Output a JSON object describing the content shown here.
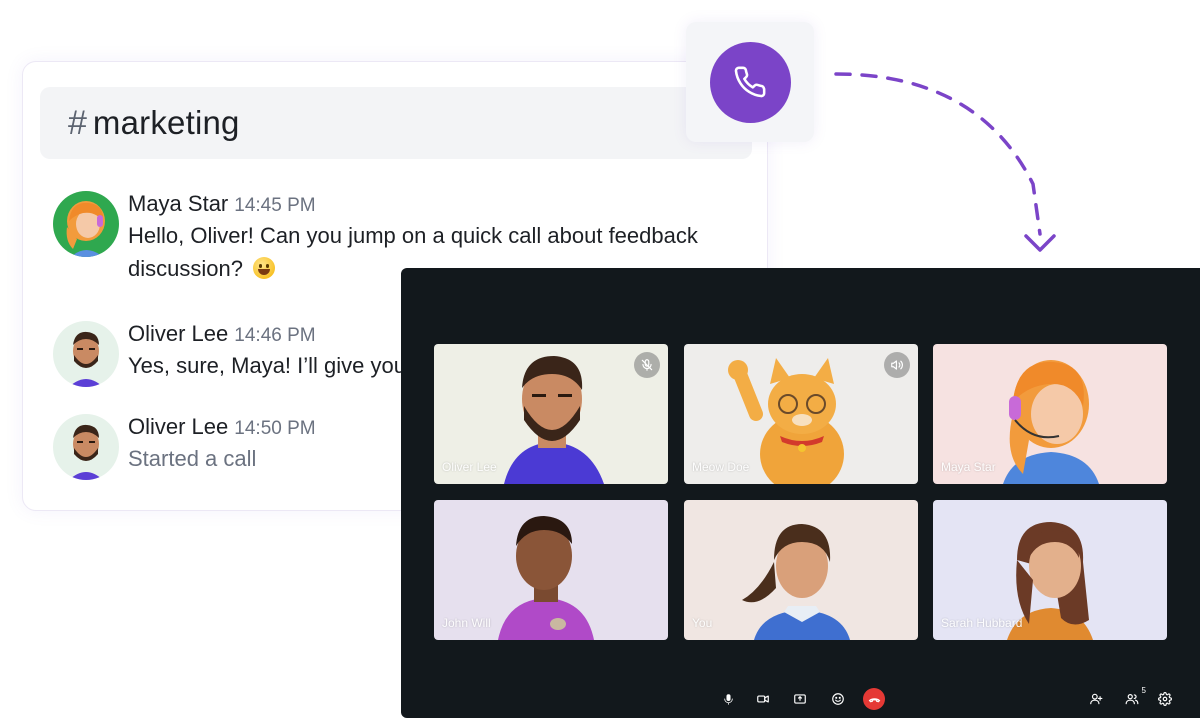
{
  "channel": {
    "hash": "#",
    "name": "marketing"
  },
  "messages": [
    {
      "author": "Maya Star",
      "time": "14:45 PM",
      "text": "Hello, Oliver! Can you jump on a quick call about feedback",
      "text2": "discussion? "
    },
    {
      "author": "Oliver Lee",
      "time": "14:46 PM",
      "text": "Yes, sure, Maya! I’ll give you"
    },
    {
      "author": "Oliver Lee",
      "time": "14:50 PM",
      "text": "Started a call"
    }
  ],
  "call_button": {
    "icon": "phone-icon",
    "color": "#7b44c8"
  },
  "participants": [
    {
      "name": "Oliver Lee",
      "badge": "mic-muted-icon",
      "bg": "#eeefe6"
    },
    {
      "name": "Meow Doe",
      "badge": "speaker-icon",
      "bg": "#eeedeb"
    },
    {
      "name": "Maya Star",
      "badge": "",
      "bg": "#f6e2e1"
    },
    {
      "name": "John Will",
      "badge": "",
      "bg": "#e6e0ee"
    },
    {
      "name": "You",
      "badge": "",
      "bg": "#f0e6e2"
    },
    {
      "name": "Sarah Hubbard",
      "badge": "",
      "bg": "#e4e4f4"
    }
  ],
  "controls": {
    "left": [
      "mic-icon",
      "camera-icon",
      "screen-share-icon",
      "emoji-icon",
      "end-call-icon"
    ],
    "right": [
      "add-person-icon",
      "participants-icon",
      "settings-icon"
    ],
    "participants_count": "5"
  },
  "colors": {
    "accent": "#7b44c8",
    "panel": "#12181c",
    "end_call": "#e53935"
  }
}
